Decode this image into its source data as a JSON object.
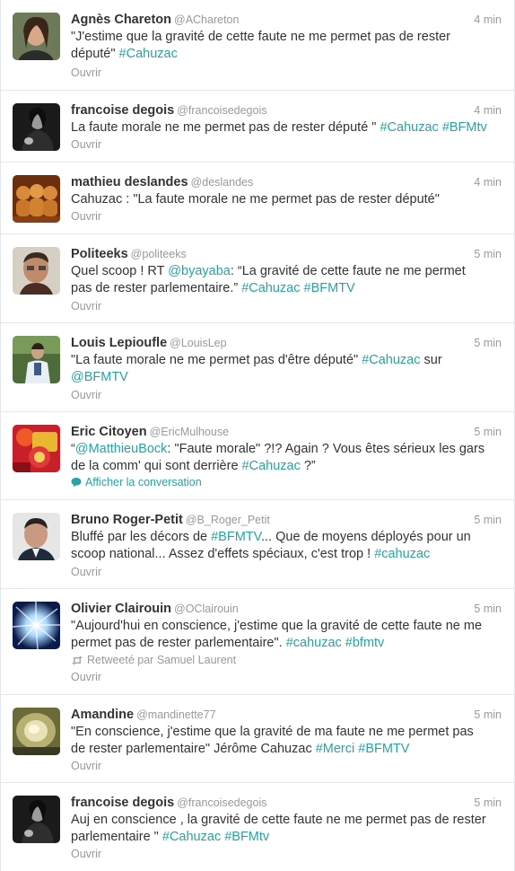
{
  "tweets": [
    {
      "fullname": "Agnès Chareton",
      "username": "@AChareton",
      "time": "4 min",
      "lines": [
        [
          {
            "t": "\"J'estime que la gravité de cette faute ne me permet pas de rester"
          }
        ],
        [
          {
            "t": "député\" "
          },
          {
            "t": "#Cahuzac",
            "h": true
          }
        ]
      ],
      "action": "Ouvrir"
    },
    {
      "fullname": "francoise degois",
      "username": "@francoisedegois",
      "time": "4 min",
      "lines": [
        [
          {
            "t": "La faute morale ne me permet pas de rester député \" "
          },
          {
            "t": "#Cahuzac",
            "h": true
          },
          {
            "t": " "
          },
          {
            "t": "#BFMtv",
            "h": true
          }
        ]
      ],
      "action": "Ouvrir"
    },
    {
      "fullname": "mathieu deslandes",
      "username": "@deslandes",
      "time": "4 min",
      "lines": [
        [
          {
            "t": "Cahuzac : \"La faute morale ne me permet pas de rester député\""
          }
        ]
      ],
      "action": "Ouvrir"
    },
    {
      "fullname": "Politeeks",
      "username": "@politeeks",
      "time": "5 min",
      "lines": [
        [
          {
            "t": "Quel scoop ! RT "
          },
          {
            "t": "@byayaba",
            "h": true
          },
          {
            "t": ": “La gravité de cette faute ne me permet"
          }
        ],
        [
          {
            "t": "pas de rester parlementaire.” "
          },
          {
            "t": "#Cahuzac",
            "h": true
          },
          {
            "t": " "
          },
          {
            "t": "#BFMTV",
            "h": true
          }
        ]
      ],
      "action": "Ouvrir"
    },
    {
      "fullname": "Louis Lepioufle",
      "username": "@LouisLep",
      "time": "5 min",
      "lines": [
        [
          {
            "t": "\"La faute morale ne me permet pas d'être député\" "
          },
          {
            "t": "#Cahuzac",
            "h": true
          },
          {
            "t": " sur"
          }
        ],
        [
          {
            "t": "@BFMTV",
            "h": true
          }
        ]
      ],
      "action": "Ouvrir"
    },
    {
      "fullname": "Eric Citoyen",
      "username": "@EricMulhouse",
      "time": "5 min",
      "lines": [
        [
          {
            "t": "“"
          },
          {
            "t": "@MatthieuBock",
            "h": true
          },
          {
            "t": ": \"Faute morale\" ?!? Again ? Vous êtes sérieux les gars"
          }
        ],
        [
          {
            "t": "de la comm' qui sont derrière "
          },
          {
            "t": "#Cahuzac",
            "h": true
          },
          {
            "t": " ?”"
          }
        ]
      ],
      "action": "Afficher la conversation",
      "action_icon": "speech-bubble-icon"
    },
    {
      "fullname": "Bruno Roger-Petit",
      "username": "@B_Roger_Petit",
      "time": "5 min",
      "lines": [
        [
          {
            "t": "Bluffé par les décors de "
          },
          {
            "t": "#BFMTV",
            "h": true
          },
          {
            "t": "... Que de moyens déployés pour un"
          }
        ],
        [
          {
            "t": "scoop national... Assez d'effets spéciaux, c'est trop ! "
          },
          {
            "t": "#cahuzac",
            "h": true
          }
        ]
      ],
      "action": "Ouvrir"
    },
    {
      "fullname": "Olivier Clairouin",
      "username": "@OClairouin",
      "time": "5 min",
      "lines": [
        [
          {
            "t": "\"Aujourd'hui en conscience, j'estime que la gravité de cette faute ne me"
          }
        ],
        [
          {
            "t": "permet pas de rester parlementaire\". "
          },
          {
            "t": "#cahuzac",
            "h": true
          },
          {
            "t": " "
          },
          {
            "t": "#bfmtv",
            "h": true
          }
        ]
      ],
      "retweeted": "Retweeté par Samuel Laurent",
      "retweet_icon": "retweet-icon",
      "action": "Ouvrir"
    },
    {
      "fullname": "Amandine",
      "username": "@mandinette77",
      "time": "5 min",
      "lines": [
        [
          {
            "t": "\"En conscience, j'estime que la gravité de ma faute ne me permet pas"
          }
        ],
        [
          {
            "t": "de rester parlementaire\" Jérôme Cahuzac "
          },
          {
            "t": "#Merci",
            "h": true
          },
          {
            "t": " "
          },
          {
            "t": "#BFMTV",
            "h": true
          }
        ]
      ],
      "action": "Ouvrir"
    },
    {
      "fullname": "francoise degois",
      "username": "@francoisedegois",
      "time": "5 min",
      "lines": [
        [
          {
            "t": "Auj en conscience , la gravité de cette faute ne me permet pas de rester"
          }
        ],
        [
          {
            "t": "parlementaire \" "
          },
          {
            "t": "#Cahuzac",
            "h": true
          },
          {
            "t": " "
          },
          {
            "t": "#BFMtv",
            "h": true
          }
        ]
      ],
      "action": "Ouvrir"
    }
  ]
}
